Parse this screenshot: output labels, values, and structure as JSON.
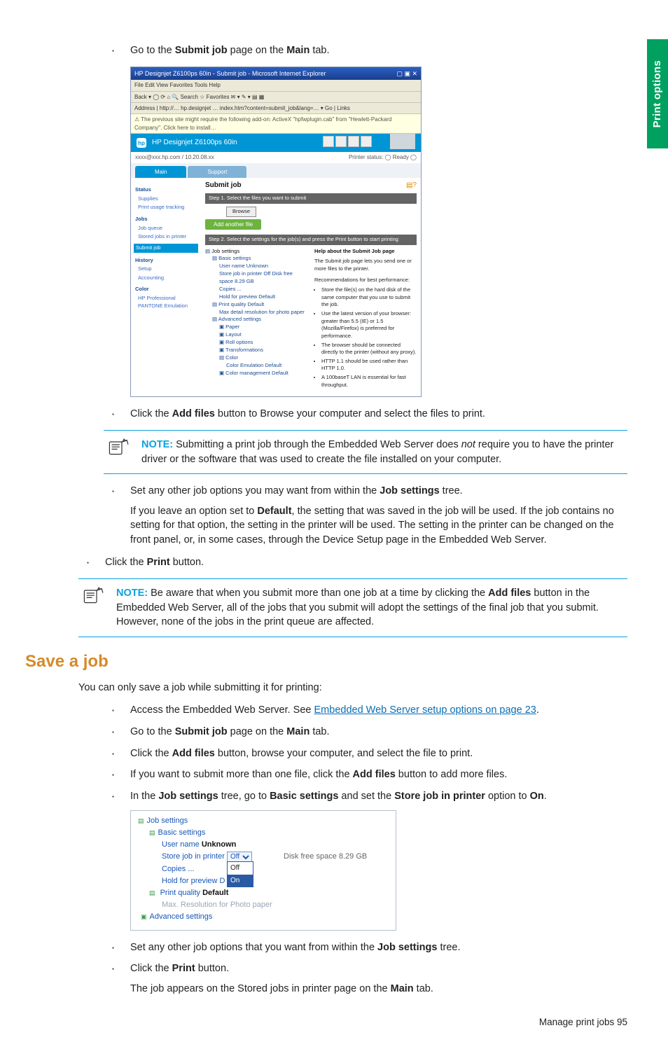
{
  "side_tab": "Print options",
  "steps_top": {
    "s1_pre": "Go to the ",
    "s1_bold1": "Submit job",
    "s1_mid": " page on the ",
    "s1_bold2": "Main",
    "s1_post": " tab.",
    "s2_pre": "Click the ",
    "s2_bold": "Add files",
    "s2_post": " button to Browse your computer and select the files to print."
  },
  "note1": {
    "label": "NOTE:",
    "text_pre": "Submitting a print job through the Embedded Web Server does ",
    "text_ital": "not",
    "text_post": " require you to have the printer driver or the software that was used to create the file installed on your computer."
  },
  "steps_mid": {
    "s3_pre": "Set any other job options you may want from within the ",
    "s3_bold": "Job settings",
    "s3_post": " tree.",
    "s3_para_pre": "If you leave an option set to ",
    "s3_para_bold": "Default",
    "s3_para_post": ", the setting that was saved in the job will be used. If the job contains no setting for that option, the setting in the printer will be used. The setting in the printer can be changed on the front panel, or, in some cases, through the Device Setup page in the Embedded Web Server.",
    "s4_pre": "Click the ",
    "s4_bold": "Print",
    "s4_post": " button."
  },
  "note2": {
    "label": "NOTE:",
    "text_pre": "Be aware that when you submit more than one job at a time by clicking the ",
    "text_bold": "Add files",
    "text_post": " button in the Embedded Web Server, all of the jobs that you submit will adopt the settings of the final job that you submit. However, none of the jobs in the print queue are affected."
  },
  "heading": "Save a job",
  "lead": "You can only save a job while submitting it for printing:",
  "save_steps": {
    "a_pre": "Access the Embedded Web Server. See ",
    "a_link": "Embedded Web Server setup options on page 23",
    "a_post": ".",
    "b_pre": "Go to the ",
    "b_bold1": "Submit job",
    "b_mid": " page on the ",
    "b_bold2": "Main",
    "b_post": " tab.",
    "c_pre": "Click the ",
    "c_bold": "Add files",
    "c_post": " button, browse your computer, and select the file to print.",
    "d_pre": "If you want to submit more than one file, click the ",
    "d_bold": "Add files",
    "d_post": " button to add more files.",
    "e_pre": "In the ",
    "e_bold1": "Job settings",
    "e_mid1": " tree, go to ",
    "e_bold2": "Basic settings",
    "e_mid2": " and set the ",
    "e_bold3": "Store job in printer",
    "e_mid3": " option to ",
    "e_bold4": "On",
    "e_post": ".",
    "f_pre": "Set any other job options that you want from within the ",
    "f_bold": "Job settings",
    "f_post": " tree.",
    "g_pre": "Click the ",
    "g_bold": "Print",
    "g_post": " button.",
    "g_para_pre": "The job appears on the Stored jobs in printer page on the ",
    "g_para_bold": "Main",
    "g_para_post": " tab."
  },
  "tree": {
    "job_settings": "Job settings",
    "basic": "Basic settings",
    "user_pre": "User name ",
    "user_val": "Unknown",
    "store_label": "Store job in printer",
    "store_sel": "Off",
    "disk_free": "Disk free space 8.29 GB",
    "copies": "Copies ...",
    "hold": "Hold for preview D",
    "opt_off": "Off",
    "opt_on": "On",
    "print_quality": "Print quality ",
    "pq_val": "Default",
    "max_res": "Max. Resolution for Photo paper",
    "advanced": "Advanced settings"
  },
  "ews": {
    "title": "HP Designjet Z6100ps 60in - Submit job - Microsoft Internet Explorer",
    "menus": "File   Edit   View   Favorites   Tools   Help",
    "toolbar": "Back  ▾   ◯   ⟳  ⌂  🔍 Search  ☆ Favorites   ✉  ▾  ✎  ▾  ▤  ▦",
    "product": "HP Designjet Z6100ps 60in",
    "status_left": "xxxx@xxx.hp.com / 10.20.08.xx",
    "status_right": "Printer status:  ◯  Ready  ◯",
    "tab_main": "Main",
    "tab_support": "Support",
    "submit": "Submit job",
    "step1": "Step 1. Select the files you want to submit",
    "browse": "Browse",
    "addfiles": "Add another file",
    "step2": "Step 2. Select the settings for the job(s) and press the Print button to start printing",
    "help_title": "Help about the Submit Job page",
    "help_text": "The Submit job page lets you send one or more files to the printer.",
    "rec_title": "Recommendations for best performance:",
    "rec1": "Store the file(s) on the hard disk of the same computer that you use to submit the job.",
    "rec2": "Use the latest version of your browser: greater than 5.5 (IE) or 1.5 (Mozilla/Firefox) is preferred for performance.",
    "rec3": "The browser should be connected directly to the printer (without any proxy).",
    "rec4": "HTTP 1.1 should be used rather than HTTP 1.0.",
    "rec5": "A 100baseT LAN is essential for fast throughput.",
    "side": {
      "status": "Status",
      "supplies": "Supplies",
      "usage": "Print usage tracking",
      "jobs": "Jobs",
      "queue": "Job queue",
      "stored": "Stored jobs in printer",
      "submit": "Submit job",
      "history": "History",
      "setup": "Setup",
      "accounting": "Accounting",
      "color": "Color",
      "pantone": "HP Professional PANTONE Emulation"
    },
    "tree": {
      "job_settings": "Job settings",
      "basic": "Basic settings",
      "user": "User name Unknown",
      "store": "Store job in printer Off Disk free space 8.29 GB",
      "copies": "Copies ...",
      "hold": "Hold for preview Default",
      "pq": "Print quality Default",
      "maxres": "Max detail resolution for photo paper",
      "adv": "Advanced settings",
      "paper": "Paper",
      "layout": "Layout",
      "roll": "Roll options",
      "trans": "Transformations",
      "color": "Color",
      "colormgmt": "Color Emulation Default",
      "cmgmt2": "Color management Default"
    }
  },
  "footer": "Manage print jobs   95"
}
